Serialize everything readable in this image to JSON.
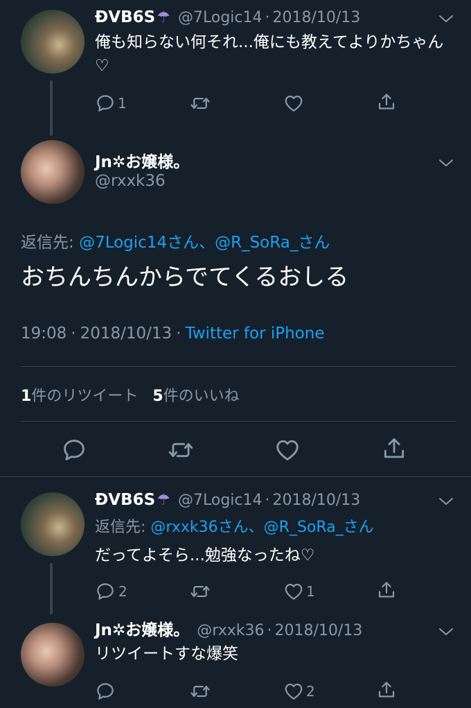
{
  "tweets": [
    {
      "name": "ĐVB6S",
      "handle": "@7Logic14",
      "date": "2018/10/13",
      "text": "俺も知らない何それ...俺にも教えてよりかちゃん♡",
      "reply_count": "1",
      "retweet_count": "",
      "like_count": ""
    },
    {
      "name": "Jn✲お嬢様。",
      "handle": "@rxxk36",
      "reply_to_label": "返信先:",
      "reply_to_1": "@7Logic14さん",
      "reply_to_sep": "、",
      "reply_to_2": "@R_SoRa_さん",
      "text": "おちんちんからでてくるおしる",
      "time": "19:08",
      "date": "2018/10/13",
      "source": "Twitter for iPhone",
      "retweets_num": "1",
      "retweets_label": "件のリツイート",
      "likes_num": "5",
      "likes_label": "件のいいね"
    },
    {
      "name": "ĐVB6S",
      "handle": "@7Logic14",
      "date": "2018/10/13",
      "reply_to_label": "返信先:",
      "reply_to_1": "@rxxk36さん",
      "reply_to_sep": "、",
      "reply_to_2": "@R_SoRa_さん",
      "text": "だってよそら...勉強なったね♡",
      "reply_count": "2",
      "retweet_count": "",
      "like_count": "1"
    },
    {
      "name": "Jn✲お嬢様。",
      "handle": "@rxxk36",
      "date": "2018/10/13",
      "text": "リツイートすな爆笑",
      "reply_count": "",
      "retweet_count": "",
      "like_count": "2"
    }
  ],
  "separator_dot": "·",
  "umbrella_emoji": "☂",
  "colors": {
    "background": "#15202b",
    "text": "#ffffff",
    "secondary": "#8899a6",
    "link": "#1da1f2",
    "divider": "#38444d"
  },
  "icons": [
    "reply-icon",
    "retweet-icon",
    "like-icon",
    "share-icon",
    "chevron-down-icon"
  ]
}
